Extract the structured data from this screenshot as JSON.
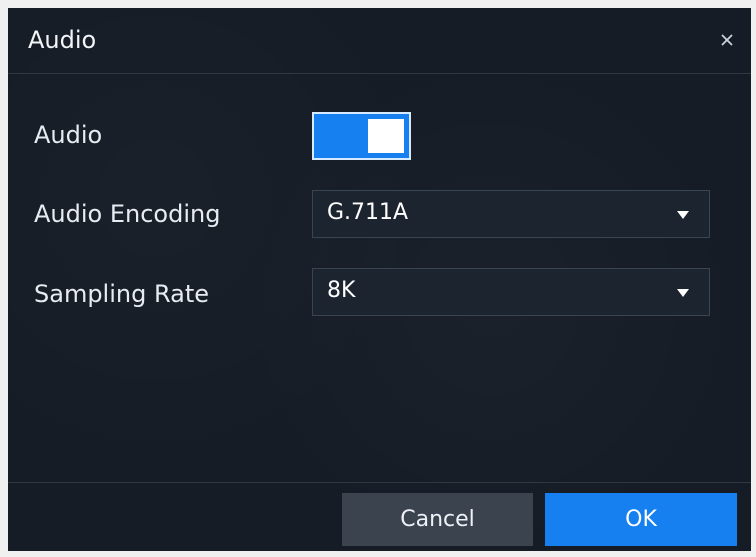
{
  "dialog": {
    "title": "Audio",
    "close_icon": "close-icon"
  },
  "form": {
    "audio": {
      "label": "Audio",
      "enabled": true,
      "accent_color": "#1780f0"
    },
    "audio_encoding": {
      "label": "Audio Encoding",
      "value": "G.711A",
      "icon": "chevron-down-icon"
    },
    "sampling_rate": {
      "label": "Sampling Rate",
      "value": "8K",
      "icon": "chevron-down-icon"
    }
  },
  "footer": {
    "cancel_label": "Cancel",
    "ok_label": "OK"
  }
}
